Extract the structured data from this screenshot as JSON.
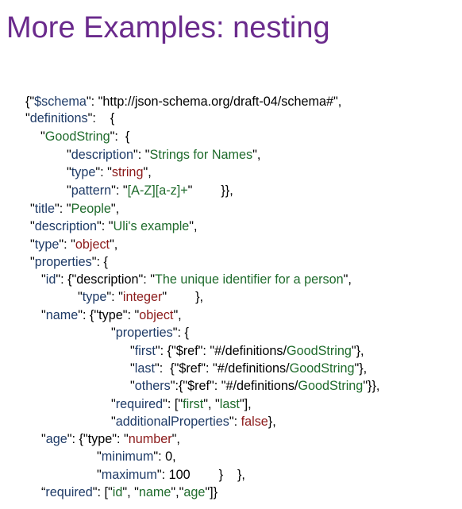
{
  "title": "More Examples: nesting",
  "lines": [
    [
      [
        "p",
        "{\""
      ],
      [
        "k",
        "$schema"
      ],
      [
        "p",
        "\": \"http://json-schema.org/draft-04/schema#\","
      ]
    ],
    [
      [
        "p",
        "\""
      ],
      [
        "k",
        "definitions"
      ],
      [
        "p",
        "\":    {"
      ]
    ],
    [
      [
        "p",
        "\""
      ],
      [
        "s",
        "GoodString"
      ],
      [
        "p",
        "\":  {"
      ]
    ],
    [
      [
        "p",
        "\""
      ],
      [
        "k",
        "description"
      ],
      [
        "p",
        "\": \""
      ],
      [
        "s",
        "Strings for Names"
      ],
      [
        "p",
        "\","
      ]
    ],
    [
      [
        "p",
        "\""
      ],
      [
        "k",
        "type"
      ],
      [
        "p",
        "\": \""
      ],
      [
        "v",
        "string"
      ],
      [
        "p",
        "\","
      ]
    ],
    [
      [
        "p",
        "\""
      ],
      [
        "k",
        "pattern"
      ],
      [
        "p",
        "\": \""
      ],
      [
        "s",
        "[A-Z][a-z]+"
      ],
      [
        "p",
        "\"        }},"
      ]
    ],
    [
      [
        "p",
        "\""
      ],
      [
        "k",
        "title"
      ],
      [
        "p",
        "\": \""
      ],
      [
        "s",
        "People"
      ],
      [
        "p",
        "\","
      ]
    ],
    [
      [
        "p",
        "\""
      ],
      [
        "k",
        "description"
      ],
      [
        "p",
        "\": \""
      ],
      [
        "s",
        "Uli's example"
      ],
      [
        "p",
        "\","
      ]
    ],
    [
      [
        "p",
        "\""
      ],
      [
        "k",
        "type"
      ],
      [
        "p",
        "\": \""
      ],
      [
        "v",
        "object"
      ],
      [
        "p",
        "\","
      ]
    ],
    [
      [
        "p",
        "\""
      ],
      [
        "k",
        "properties"
      ],
      [
        "p",
        "\": {"
      ]
    ],
    [
      [
        "p",
        "\""
      ],
      [
        "k",
        "id"
      ],
      [
        "p",
        "\": {\"description\": \""
      ],
      [
        "s",
        "The unique identifier for a person"
      ],
      [
        "p",
        "\","
      ]
    ],
    [
      [
        "p",
        "\""
      ],
      [
        "k",
        "type"
      ],
      [
        "p",
        "\": \""
      ],
      [
        "v",
        "integer"
      ],
      [
        "p",
        "\"        },"
      ]
    ],
    [
      [
        "p",
        "\""
      ],
      [
        "k",
        "name"
      ],
      [
        "p",
        "\": {\"type\": \""
      ],
      [
        "v",
        "object"
      ],
      [
        "p",
        "\","
      ]
    ],
    [
      [
        "p",
        "\""
      ],
      [
        "k",
        "properties"
      ],
      [
        "p",
        "\": {"
      ]
    ],
    [
      [
        "p",
        "\""
      ],
      [
        "k",
        "first"
      ],
      [
        "p",
        "\": {\"$ref\": \"#/definitions/"
      ],
      [
        "s",
        "GoodString"
      ],
      [
        "p",
        "\"},"
      ]
    ],
    [
      [
        "p",
        "\""
      ],
      [
        "k",
        "last"
      ],
      [
        "p",
        "\":  {\"$ref\": \"#/definitions/"
      ],
      [
        "s",
        "GoodString"
      ],
      [
        "p",
        "\"},"
      ]
    ],
    [
      [
        "p",
        "\""
      ],
      [
        "k",
        "others"
      ],
      [
        "p",
        "\":{\"$ref\": \"#/definitions/"
      ],
      [
        "s",
        "GoodString"
      ],
      [
        "p",
        "\"}},"
      ]
    ],
    [
      [
        "p",
        "\""
      ],
      [
        "k",
        "required"
      ],
      [
        "p",
        "\": [\""
      ],
      [
        "s",
        "first"
      ],
      [
        "p",
        "\", \""
      ],
      [
        "s",
        "last"
      ],
      [
        "p",
        "\"],"
      ]
    ],
    [
      [
        "p",
        "\""
      ],
      [
        "k",
        "additionalProperties"
      ],
      [
        "p",
        "\": "
      ],
      [
        "v",
        "false"
      ],
      [
        "p",
        "},"
      ]
    ],
    [
      [
        "p",
        "\""
      ],
      [
        "k",
        "age"
      ],
      [
        "p",
        "\": {\"type\": \""
      ],
      [
        "v",
        "number"
      ],
      [
        "p",
        "\","
      ]
    ],
    [
      [
        "p",
        "\""
      ],
      [
        "k",
        "minimum"
      ],
      [
        "p",
        "\": 0,"
      ]
    ],
    [
      [
        "p",
        "\""
      ],
      [
        "k",
        "maximum"
      ],
      [
        "p",
        "\": 100        }    },"
      ]
    ],
    [
      [
        "p",
        "“"
      ],
      [
        "k",
        "required"
      ],
      [
        "p",
        "\": [\""
      ],
      [
        "s",
        "id"
      ],
      [
        "p",
        "\", \""
      ],
      [
        "s",
        "name"
      ],
      [
        "p",
        "\",\""
      ],
      [
        "s",
        "age"
      ],
      [
        "p",
        "\"]}"
      ]
    ]
  ]
}
